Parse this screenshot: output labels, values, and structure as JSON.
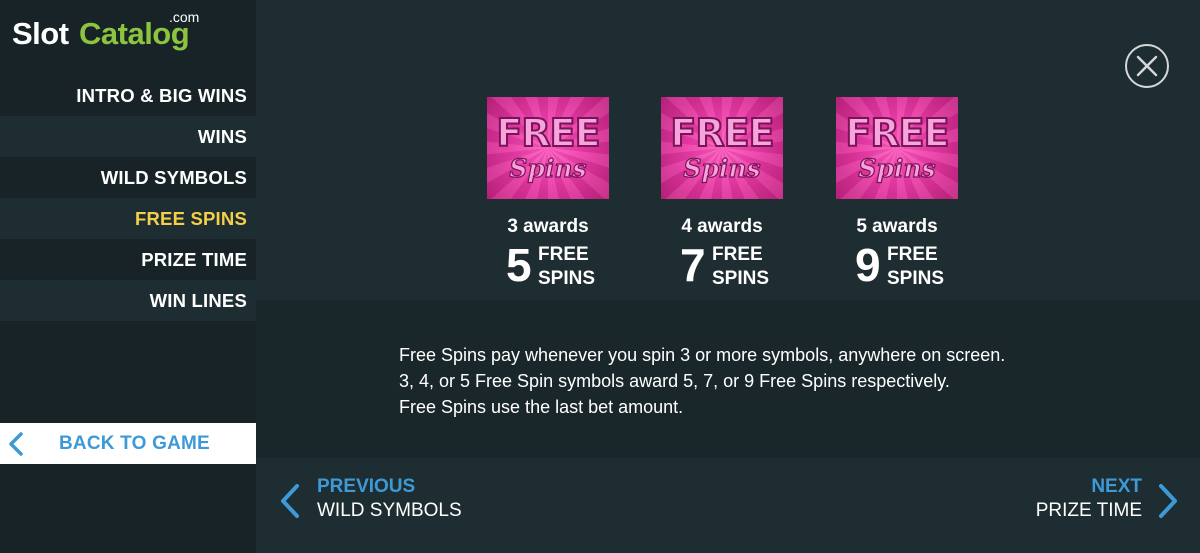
{
  "logo": {
    "slot": "Slot",
    "catalog": "Catalog",
    "com": ".com"
  },
  "sidebar": {
    "items": [
      {
        "label": "INTRO & BIG WINS"
      },
      {
        "label": "WINS"
      },
      {
        "label": "WILD SYMBOLS"
      },
      {
        "label": "FREE SPINS",
        "active": true
      },
      {
        "label": "PRIZE TIME"
      },
      {
        "label": "WIN LINES"
      }
    ],
    "back_label": "BACK TO GAME"
  },
  "colors": {
    "accent": "#3d9ad6",
    "active": "#f4cf47",
    "brand_green": "#8cc43f",
    "symbol_pink": "#ec3aa7"
  },
  "symbol": {
    "free": "FREE",
    "spins": "Spins"
  },
  "awards": [
    {
      "count": "3 awards",
      "num": "5",
      "free": "FREE",
      "spins": "SPINS"
    },
    {
      "count": "4 awards",
      "num": "7",
      "free": "FREE",
      "spins": "SPINS"
    },
    {
      "count": "5 awards",
      "num": "9",
      "free": "FREE",
      "spins": "SPINS"
    }
  ],
  "description": [
    "Free Spins pay whenever you spin 3 or more symbols, anywhere on screen.",
    "3, 4, or 5 Free Spin symbols award 5, 7, or 9 Free Spins respectively.",
    "Free Spins use the last bet amount."
  ],
  "nav": {
    "previous_label": "PREVIOUS",
    "previous_target": "WILD SYMBOLS",
    "next_label": "NEXT",
    "next_target": "PRIZE TIME"
  },
  "icons": {
    "close": "close-icon",
    "back": "chevron-left-icon",
    "prev": "chevron-left-icon",
    "next": "chevron-right-icon"
  }
}
